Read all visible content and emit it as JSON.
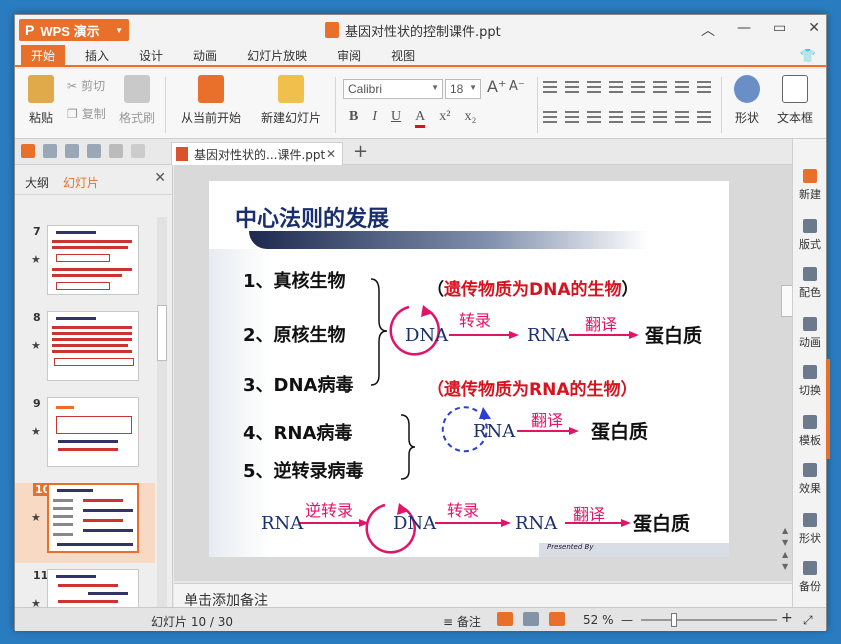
{
  "app": {
    "name": "WPS 演示",
    "logo": "P",
    "doc_title": "基因对性状的控制课件.ppt"
  },
  "window_controls": [
    "︿",
    "—",
    "▭",
    "✕"
  ],
  "tabs": [
    "开始",
    "插入",
    "设计",
    "动画",
    "幻灯片放映",
    "审阅",
    "视图"
  ],
  "ribbon": {
    "paste": "粘贴",
    "cut": "剪切",
    "copy": "复制",
    "format_painter": "格式刷",
    "from_current": "从当前开始",
    "new_slide": "新建幻灯片",
    "font_name": "Calibri",
    "font_size": "18",
    "bold": "B",
    "italic": "I",
    "underline": "U",
    "font_color": "A",
    "shape": "形状",
    "textbox": "文本框"
  },
  "quickbar": {
    "doc_tab": "基因对性状的...课件.ppt",
    "close": "✕",
    "add_tab": "+"
  },
  "left_panel": {
    "tab_outline": "大纲",
    "tab_slides": "幻灯片",
    "slides": [
      {
        "num": "7"
      },
      {
        "num": "8"
      },
      {
        "num": "9"
      },
      {
        "num": "10"
      },
      {
        "num": "11"
      }
    ]
  },
  "slide": {
    "title": "中心法则的发展",
    "items": [
      "1、真核生物",
      "2、原核生物",
      "3、DNA病毒",
      "4、RNA病毒",
      "5、逆转录病毒"
    ],
    "note_dna_open": "（",
    "note_dna_text": "遗传物质为DNA的生物",
    "note_dna_close": "）",
    "note_rna": "（遗传物质为RNA的生物）",
    "dna": "DNA",
    "rna": "RNA",
    "transcription": "转录",
    "translation": "翻译",
    "reverse_transcription": "逆转录",
    "protein": "蛋白质",
    "presented_by": "Presented By"
  },
  "notes_placeholder": "单击添加备注",
  "right_panel": [
    "新建",
    "版式",
    "配色",
    "动画",
    "切换",
    "模板",
    "效果",
    "形状",
    "备份"
  ],
  "status": {
    "slide_info": "幻灯片 10 / 30",
    "notes": "备注",
    "zoom": "52 %",
    "minus": "—",
    "plus": "+"
  },
  "colors": {
    "accent": "#e8702a",
    "title_navy": "#1a2f6e",
    "red": "#d8131f",
    "pink": "#e0156a"
  }
}
